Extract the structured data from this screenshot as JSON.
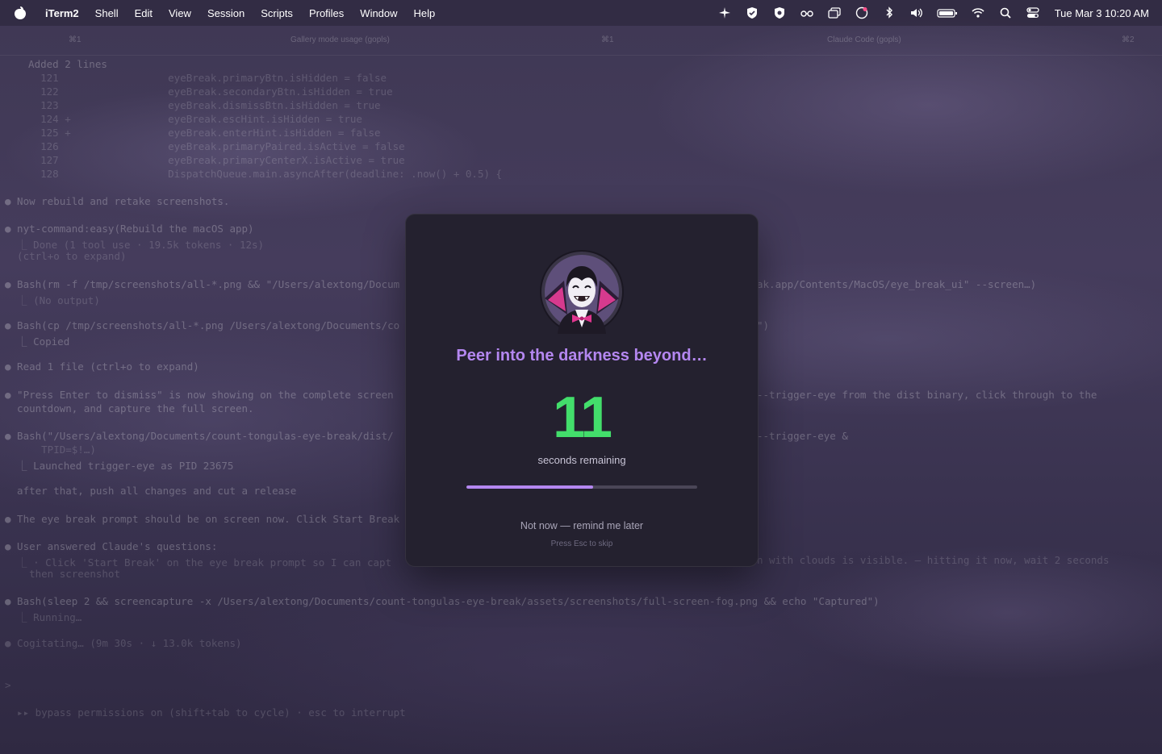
{
  "menubar": {
    "app_name": "iTerm2",
    "items": [
      "Shell",
      "Edit",
      "View",
      "Session",
      "Scripts",
      "Profiles",
      "Window",
      "Help"
    ],
    "clock": "Tue Mar 3  10:20 AM"
  },
  "tabs": [
    "⌘1",
    "Gallery mode usage (gopls)",
    "⌘1",
    "Claude Code (gopls)",
    "⌘2"
  ],
  "terminal_lines": [
    "  Added 2 lines",
    "    121                  eyeBreak.primaryBtn.isHidden = false",
    "    122                  eyeBreak.secondaryBtn.isHidden = true",
    "    123                  eyeBreak.dismissBtn.isHidden = true",
    "    124 +                eyeBreak.escHint.isHidden = true",
    "    125 +                eyeBreak.enterHint.isHidden = false",
    "    126                  eyeBreak.primaryPaired.isActive = false",
    "    127                  eyeBreak.primaryCenterX.isActive = true",
    "    128                  DispatchQueue.main.asyncAfter(deadline: .now() + 0.5) {",
    "● Now rebuild and retake screenshots.",
    "● nyt-command:easy(Rebuild the macOS app)",
    "  ⎿ Done (1 tool use · 19.5k tokens · 12s)",
    "  (ctrl+o to expand)",
    "● Bash(rm -f /tmp/screenshots/all-*.png && \"/Users/alextong/Docum",
    "  ⎿ (No output)",
    "● Bash(cp /tmp/screenshots/all-*.png /Users/alextong/Documents/co",
    "  ⎿ Copied",
    "● Read 1 file (ctrl+o to expand)",
    "● \"Press Enter to dismiss\" is now showing on the complete screen",
    "  countdown, and capture the full screen.",
    "● Bash(\"/Users/alextong/Documents/count-tongulas-eye-break/dist/",
    "      TPID=$!…)",
    "  ⎿ Launched trigger-eye as PID 23675",
    "  after that, push all changes and cut a release",
    "● The eye break prompt should be on screen now. Click Start Break",
    "● User answered Claude's questions:",
    "  ⎿ · Click 'Start Break' on the eye break prompt so I can capt",
    "    then screenshot",
    "● Bash(sleep 2 && screencapture -x /Users/alextong/Documents/count-tongulas-eye-break/assets/screenshots/full-screen-fog.png && echo \"Captured\")",
    "  ⎿ Running…",
    "● Cogitating… (9m 30s · ↓ 13.0k tokens)",
    ">",
    "  ▸▸ bypass permissions on (shift+tab to cycle) · esc to interrupt"
  ],
  "terminal_right": [
    "ak.app/Contents/MacOS/eye_break_ui\" --screen…)",
    "\")",
    "--trigger-eye from the dist binary, click through to the",
    "--trigger-eye &",
    "n with clouds is visible. — hitting it now, wait 2 seconds"
  ],
  "overlay": {
    "headline": "Peer into the darkness beyond…",
    "countdown": "11",
    "countdown_label": "seconds remaining",
    "progress_fraction": 0.55,
    "later_link": "Not now — remind me later",
    "esc_hint": "Press Esc to skip",
    "accent_color": "#b487f0",
    "countdown_color": "#43de6b",
    "avatar_icon": "vampire-mascot"
  },
  "status_icons": [
    "airplane-icon",
    "shield-check-icon",
    "shield-icon",
    "glasses-icon",
    "window-stack-icon",
    "account-badge-icon",
    "bluetooth-icon",
    "volume-icon",
    "battery-icon",
    "wifi-icon",
    "search-icon",
    "control-center-icon"
  ]
}
